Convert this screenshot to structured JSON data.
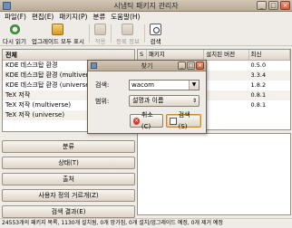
{
  "window": {
    "title": "시냅틱 패키지 관리자"
  },
  "menubar": {
    "items": [
      "파일(F)",
      "편집(E)",
      "패키지(P)",
      "분류",
      "도움말(H)"
    ]
  },
  "toolbar": {
    "reload": "다시 읽기",
    "upgrade": "업그레이드 모두 표시",
    "apply": "적용",
    "properties": "등록 정보",
    "search": "검색"
  },
  "categories": {
    "header": "전체",
    "items": [
      "KDE 데스크탑 환경",
      "KDE 데스크탑 환경 (multiverse)",
      "KDE 데스크탑 환경 (universe)",
      "TeX 저작",
      "TeX 저작 (multiverse)",
      "TeX 저작 (universe)"
    ]
  },
  "side_buttons": {
    "sections": "분류",
    "status": "상태(T)",
    "origin": "출처",
    "custom": "사용자 정의 거르개(Z)",
    "results": "검색 결과(E)"
  },
  "package_table": {
    "headers": {
      "s": "S",
      "package": "패키지",
      "installed": "설치된 버전",
      "latest": "최신"
    },
    "rows": [
      {
        "latest": "0.5.0"
      },
      {
        "latest": "3.3.4"
      },
      {
        "latest": "1.8.2"
      },
      {
        "latest": "0.8.1"
      },
      {
        "latest": "0.8.1"
      }
    ]
  },
  "find_dialog": {
    "title": "찾기",
    "search_label": "검색:",
    "search_value": "wacom",
    "scope_label": "범위:",
    "scope_value": "설명과 이름",
    "cancel": "취소(C)",
    "find": "검색(S)"
  },
  "statusbar": {
    "text": "24553개의 패키지 목록, 1130개 설치됨, 0개 망가짐, 0개 설치/업그레이드 예정, 0개 제거 예정"
  }
}
